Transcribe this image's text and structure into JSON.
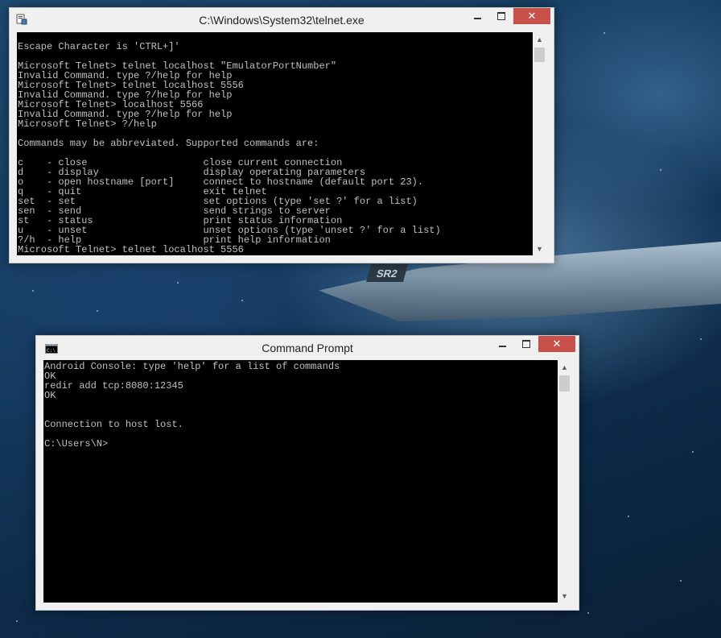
{
  "background": {
    "ship_marking": "SR2"
  },
  "telnet_window": {
    "title": "C:\\Windows\\System32\\telnet.exe",
    "icon": "telnet-app-icon",
    "controls": {
      "minimize": "minimize-icon",
      "maximize": "maximize-icon",
      "close": "✕"
    },
    "lines": [
      "",
      "Escape Character is 'CTRL+]'",
      "",
      "Microsoft Telnet> telnet localhost \"EmulatorPortNumber\"",
      "Invalid Command. type ?/help for help",
      "Microsoft Telnet> telnet localhost 5556",
      "Invalid Command. type ?/help for help",
      "Microsoft Telnet> localhost 5566",
      "Invalid Command. type ?/help for help",
      "Microsoft Telnet> ?/help",
      "",
      "Commands may be abbreviated. Supported commands are:",
      "",
      "c    - close                    close current connection",
      "d    - display                  display operating parameters",
      "o    - open hostname [port]     connect to hostname (default port 23).",
      "q    - quit                     exit telnet",
      "set  - set                      set options (type 'set ?' for a list)",
      "sen  - send                     send strings to server",
      "st   - status                   print status information",
      "u    - unset                    unset options (type 'unset ?' for a list)",
      "?/h  - help                     print help information",
      "Microsoft Telnet> telnet localhost 5556"
    ]
  },
  "cmd_window": {
    "title": "Command Prompt",
    "icon_label": "C:\\",
    "controls": {
      "minimize": "minimize-icon",
      "maximize": "maximize-icon",
      "close": "✕"
    },
    "lines": [
      "Android Console: type 'help' for a list of commands",
      "OK",
      "redir add tcp:8080:12345",
      "OK",
      "",
      "",
      "Connection to host lost.",
      "",
      "C:\\Users\\N>"
    ]
  },
  "scroll_arrows": {
    "up": "▲",
    "down": "▼"
  }
}
